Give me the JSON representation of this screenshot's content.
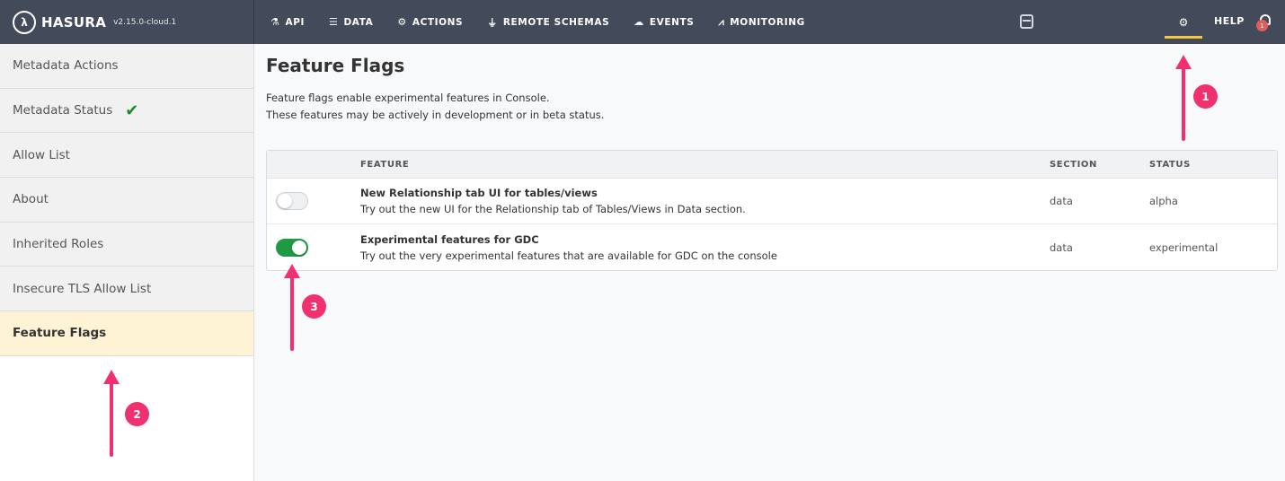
{
  "brand": {
    "name": "HASURA",
    "version": "v2.15.0-cloud.1",
    "logo_glyph": "λ"
  },
  "nav": {
    "items": [
      {
        "label": "API",
        "icon": "flask-icon"
      },
      {
        "label": "DATA",
        "icon": "database-icon"
      },
      {
        "label": "ACTIONS",
        "icon": "cogs-icon"
      },
      {
        "label": "REMOTE SCHEMAS",
        "icon": "plug-icon"
      },
      {
        "label": "EVENTS",
        "icon": "cloud-icon"
      },
      {
        "label": "MONITORING",
        "icon": "chart-line-icon"
      }
    ],
    "help_label": "HELP",
    "notification_count": "1",
    "active_accent": "#f8c541"
  },
  "sidebar": {
    "items": [
      {
        "label": "Metadata Actions"
      },
      {
        "label": "Metadata Status"
      },
      {
        "label": "Allow List"
      },
      {
        "label": "About"
      },
      {
        "label": "Inherited Roles"
      },
      {
        "label": "Insecure TLS Allow List"
      },
      {
        "label": "Feature Flags"
      }
    ],
    "active_index": 6
  },
  "main": {
    "title": "Feature Flags",
    "description_line1": "Feature flags enable experimental features in Console.",
    "description_line2": "These features may be actively in development or in beta status.",
    "table": {
      "headers": {
        "feature": "FEATURE",
        "section": "SECTION",
        "status": "STATUS"
      },
      "rows": [
        {
          "enabled": false,
          "title": "New Relationship tab UI for tables/views",
          "description": "Try out the new UI for the Relationship tab of Tables/Views in Data section.",
          "section": "data",
          "status": "alpha"
        },
        {
          "enabled": true,
          "title": "Experimental features for GDC",
          "description": "Try out the very experimental features that are available for GDC on the console",
          "section": "data",
          "status": "experimental"
        }
      ]
    }
  },
  "annotations": {
    "markers": [
      "1",
      "2",
      "3"
    ],
    "color": "#f0306f"
  },
  "colors": {
    "topbar": "#434a5a",
    "toggle_on": "#1f9943",
    "active_sidebar": "#fff3d5",
    "check": "#1f8b24"
  }
}
